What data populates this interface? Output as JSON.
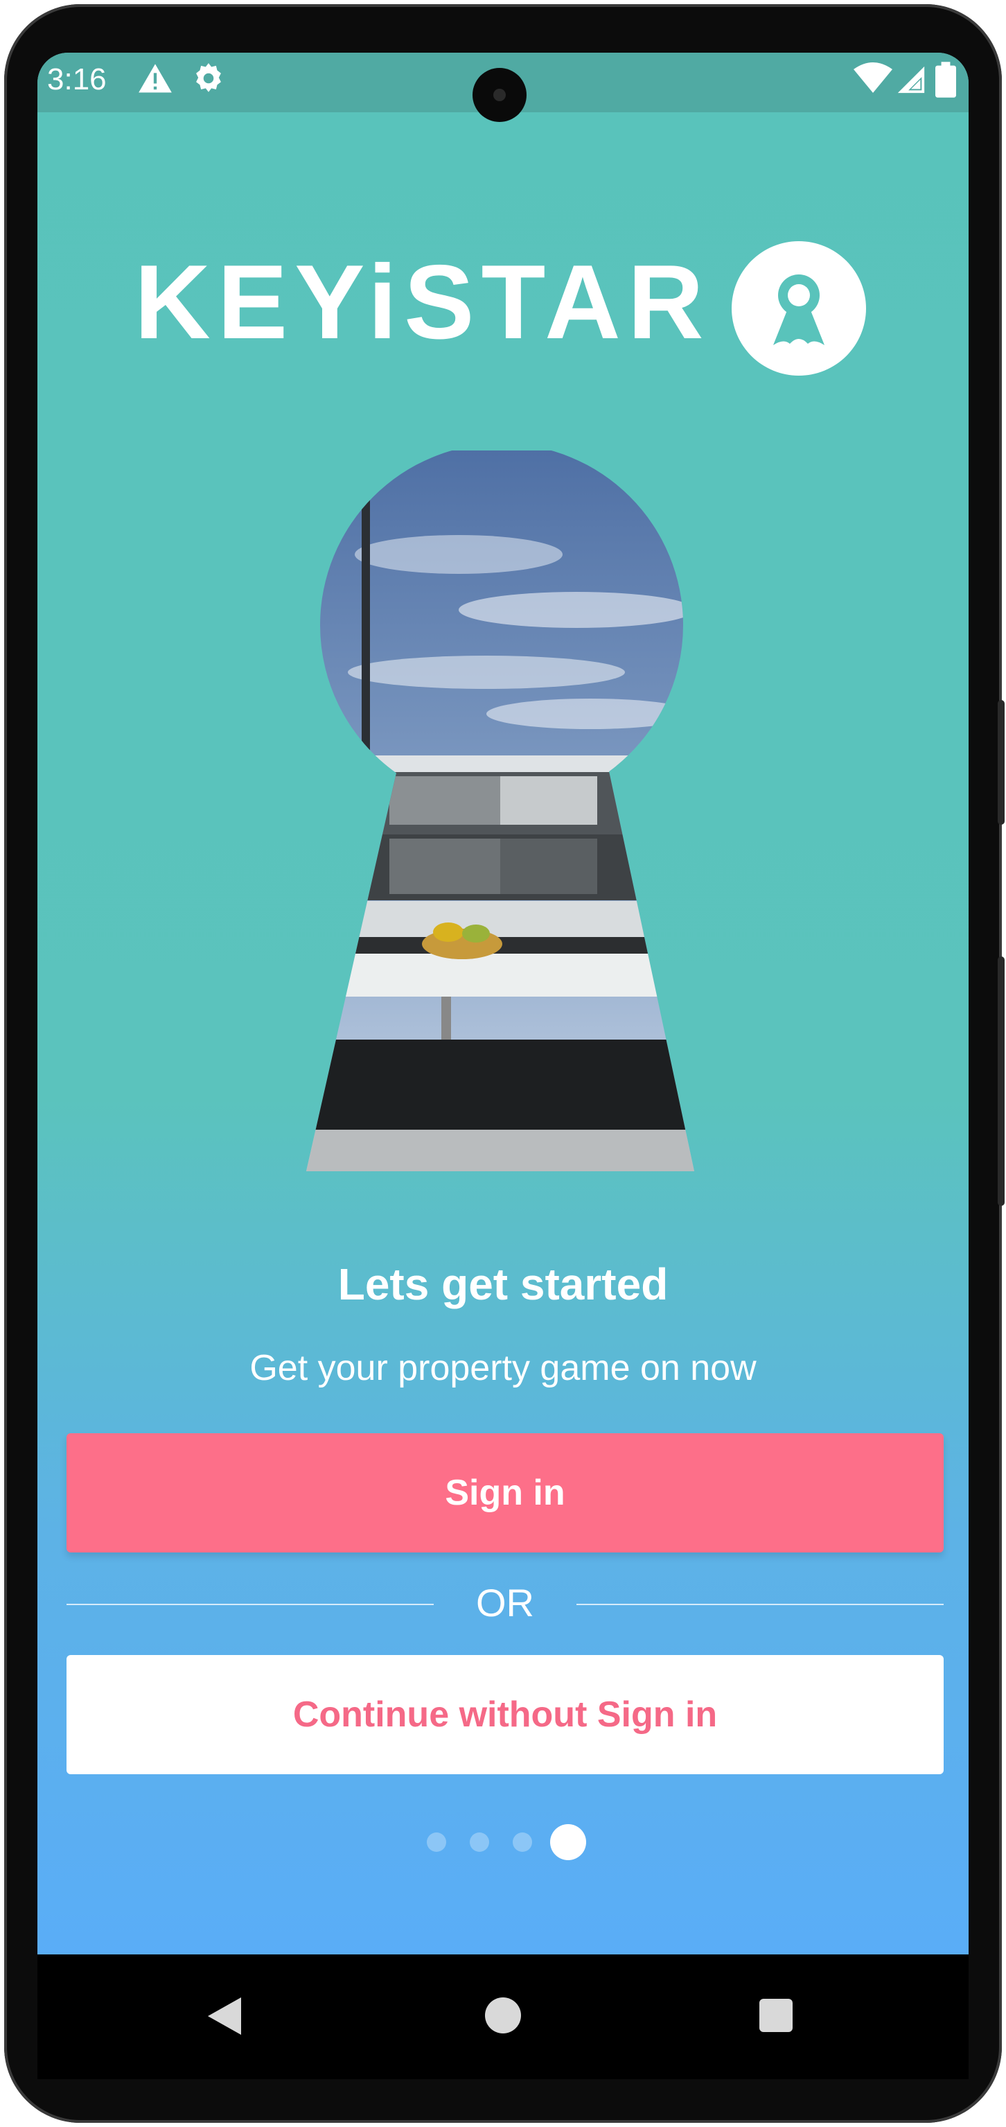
{
  "status_bar": {
    "time": "3:16",
    "icons": [
      "warning-icon",
      "settings-gear-icon",
      "wifi-icon",
      "cell-signal-icon",
      "battery-icon"
    ]
  },
  "brand": {
    "name": "KEYiSTAR",
    "color": "#ffffff"
  },
  "onboarding": {
    "title": "Lets get started",
    "subtitle": "Get your property game on now",
    "page_indicator": {
      "total": 4,
      "active": 4
    }
  },
  "actions": {
    "sign_in_label": "Sign in",
    "or_label": "OR",
    "guest_label": "Continue without Sign in"
  },
  "nav_bar": {
    "icons": [
      "back-triangle-icon",
      "home-circle-icon",
      "recents-square-icon"
    ]
  },
  "colors": {
    "background_top": "#59c3bb",
    "background_bottom": "#5aadf7",
    "primary_button": "#fd6f89",
    "secondary_text": "#f56987"
  }
}
